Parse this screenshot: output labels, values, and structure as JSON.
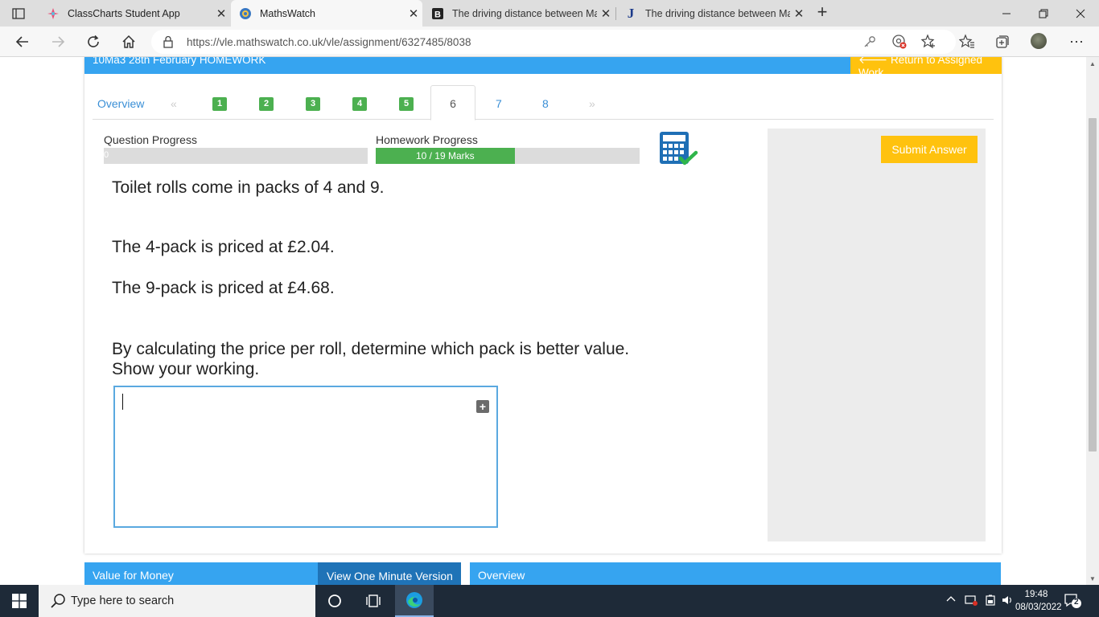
{
  "browser": {
    "tabs": [
      {
        "title": "ClassCharts Student App",
        "favicon": "classcharts-icon",
        "active": false
      },
      {
        "title": "MathsWatch",
        "favicon": "mathswatch-icon",
        "active": true
      },
      {
        "title": "The driving distance between Ma",
        "favicon": "b-icon",
        "active": false
      },
      {
        "title": "The driving distance between Ma",
        "favicon": "j-icon",
        "active": false
      }
    ],
    "url": "https://vle.mathswatch.co.uk/vle/assignment/6327485/8038"
  },
  "page": {
    "homework_title": "10Ma3 28th February HOMEWORK",
    "return_label": "Return to Assigned Work",
    "tabs": {
      "overview": "Overview",
      "prev": "«",
      "done": [
        "1",
        "2",
        "3",
        "4",
        "5"
      ],
      "current": "6",
      "upcoming": [
        "7",
        "8"
      ],
      "next": "»"
    },
    "question_progress": {
      "label": "Question Progress",
      "value_text": "0",
      "fraction": 0
    },
    "homework_progress": {
      "label": "Homework Progress",
      "value_text": "10 / 19 Marks",
      "marks": 10,
      "total": 19
    },
    "question": {
      "line1": "Toilet rolls come in packs of 4 and 9.",
      "line2": "The 4-pack is priced at £2.04.",
      "line3": "The 9-pack is priced at £4.68.",
      "line4": "By calculating the price per roll, determine which pack is better value.",
      "line5": "Show your working."
    },
    "answer": {
      "value": "",
      "expand_icon": "+"
    },
    "submit_label": "Submit Answer",
    "footer": {
      "left": "Value for Money",
      "button": "View One Minute Version",
      "right": "Overview"
    },
    "colors": {
      "brand_blue": "#36a4f0",
      "accent_yellow": "#ffc20e",
      "progress_green": "#4cb050"
    }
  },
  "taskbar": {
    "search_placeholder": "Type here to search",
    "time": "19:48",
    "date": "08/03/2022",
    "notifications": "2"
  }
}
